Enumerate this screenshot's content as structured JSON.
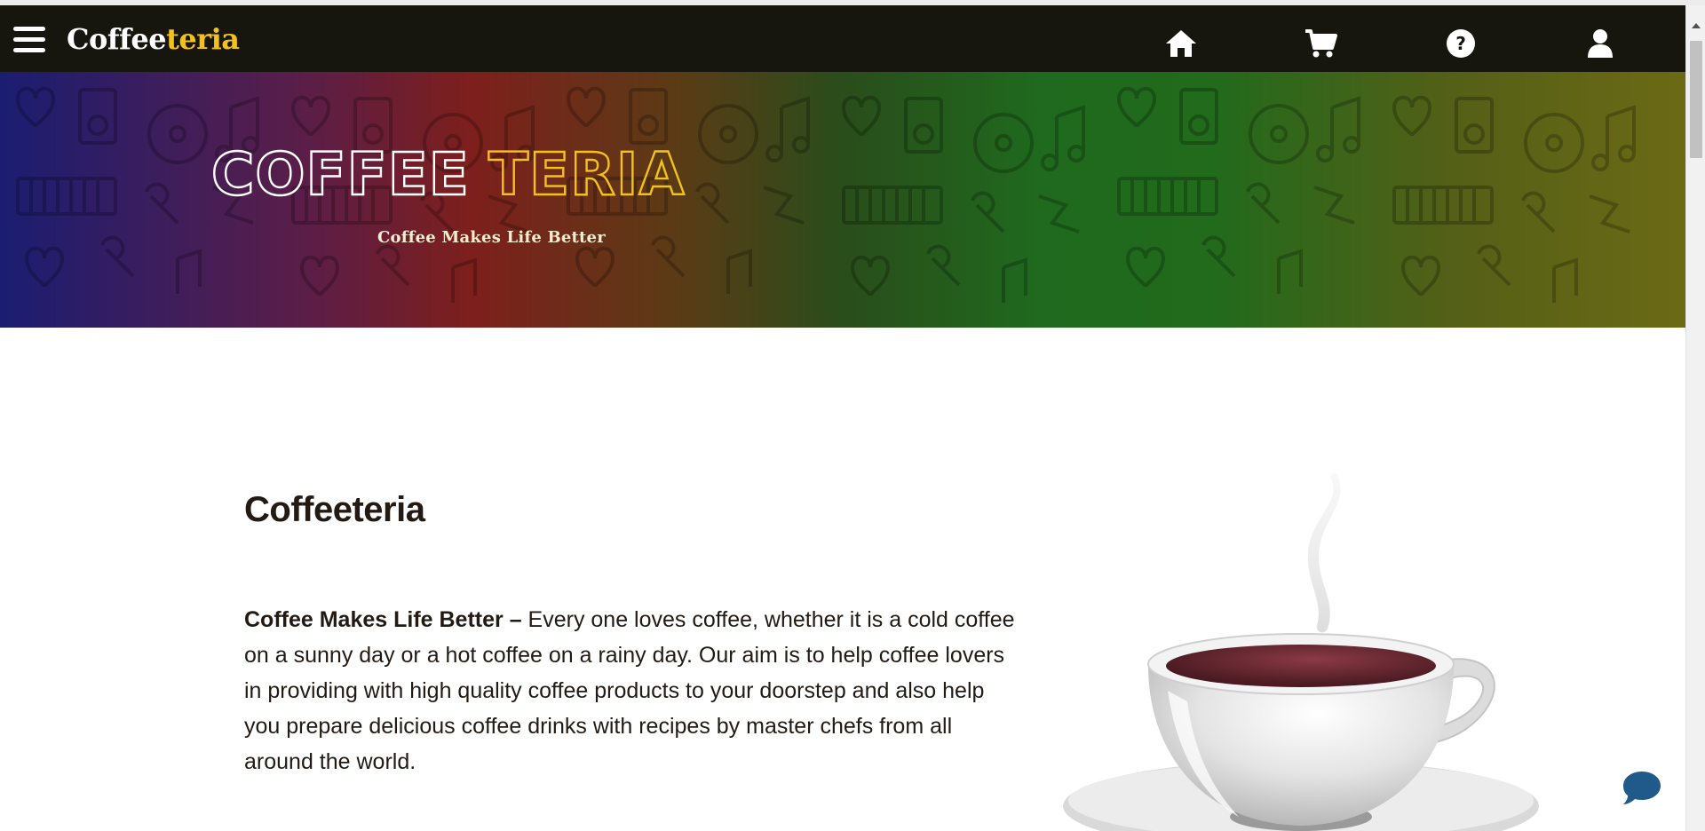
{
  "navbar": {
    "brand_main": "Coffee",
    "brand_accent": "teria",
    "icons": [
      "menu-icon",
      "home-icon",
      "cart-icon",
      "help-icon",
      "user-icon"
    ]
  },
  "hero": {
    "title_main": "COFFEE",
    "title_accent": "TERIA",
    "subtitle": "Coffee Makes Life Better"
  },
  "about": {
    "heading": "Coffeeteria",
    "lead": "Coffee Makes Life Better –",
    "body": " Every one loves coffee, whether it is a cold coffee on a sunny day or a hot coffee on a rainy day. Our aim is to help coffee lovers in providing with high quality coffee products to your doorstep and also help you prepare delicious coffee drinks with recipes by master chefs from all around the world."
  },
  "colors": {
    "navbar_bg": "#16160f",
    "accent_yellow": "#f2c21b",
    "text_dark": "#231a14",
    "chat_blue": "#1f5a8a",
    "coffee": "#6e2a33"
  }
}
